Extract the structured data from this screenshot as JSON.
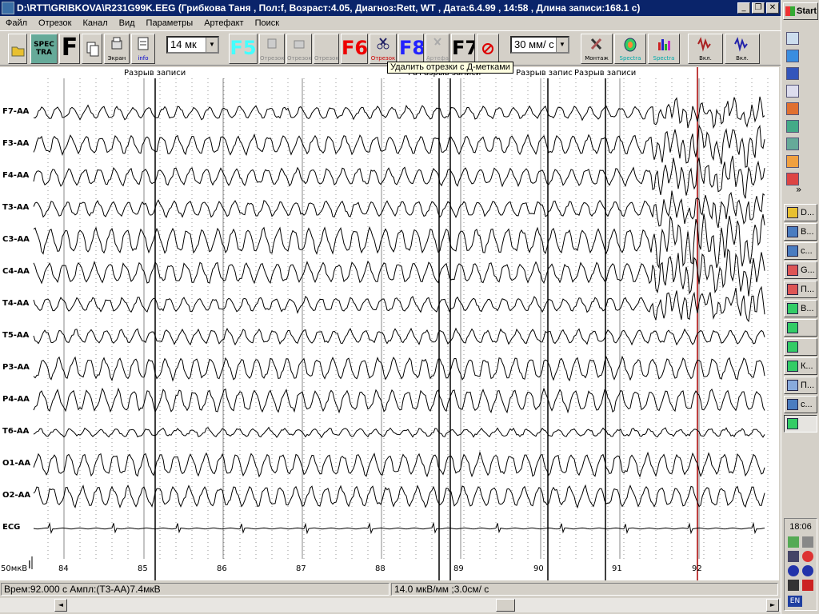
{
  "window": {
    "title": "D:\\RTT\\GRIBKOVA\\R231G99K.EEG (Грибкова Таня , Пол:f, Возраст:4.05, Диагноз:Rett, WT , Дата:6.4.99 , 14:58 , Длина записи:168.1 с)",
    "minimize": "_",
    "restore": "❐",
    "close": "✕"
  },
  "menu": [
    "Файл",
    "Отрезок",
    "Канал",
    "Вид",
    "Параметры",
    "Артефакт",
    "Поиск"
  ],
  "toolbar": {
    "spec_label": "SPEC TRA",
    "f_label": "F",
    "screen_label": "Экран",
    "info_label": "info",
    "amplitude_value": "14 мк",
    "f5_label": "F5",
    "seg1_label": "Отрезок",
    "seg2_label": "Отрезок",
    "seg3_label": "Отрезок",
    "f6_label": "F6",
    "seg_cut_label": "Отрезок",
    "f8_label": "F8",
    "artifact_label": "Артефакт",
    "f7_label": "F7",
    "speed_value": "30 мм/ с",
    "montage_label": "Монтаж",
    "spectra1_label": "Spectra",
    "spectra2_label": "Spectra",
    "on1_label": "Вкл.",
    "on2_label": "Вкл.",
    "tooltip": "Удалить отрезки с Д-метками"
  },
  "eeg": {
    "channels": [
      "F7-AA",
      "F3-AA",
      "F4-AA",
      "T3-AA",
      "C3-AA",
      "C4-AA",
      "T4-AA",
      "T5-AA",
      "P3-AA",
      "P4-AA",
      "T6-AA",
      "O1-AA",
      "O2-AA",
      "ECG"
    ],
    "time_ticks": [
      "84",
      "85",
      "86",
      "87",
      "88",
      "89",
      "90",
      "91",
      "92"
    ],
    "gap_labels": [
      "Разрыв записи",
      "Ра",
      "Разрыв записи",
      "Разрыв запис",
      "Разрыв записи"
    ],
    "scale_label": "50мкВ",
    "cursor": "I"
  },
  "status": {
    "time_amp": "Врем:92.000 с Ампл:(T3-AA)7.4мкВ",
    "scale": "14.0 мкВ/мм ;3.0см/ с"
  },
  "scrollbar": {
    "left_arrow": "◄",
    "right_arrow": "►"
  },
  "taskbar": {
    "start": "Start",
    "more": "»",
    "tasks": [
      "D...",
      "В...",
      "с...",
      "G...",
      "П...",
      "В...",
      "",
      "",
      "К...",
      "П...",
      "с...",
      ""
    ],
    "clock": "18:06",
    "language": "EN"
  }
}
